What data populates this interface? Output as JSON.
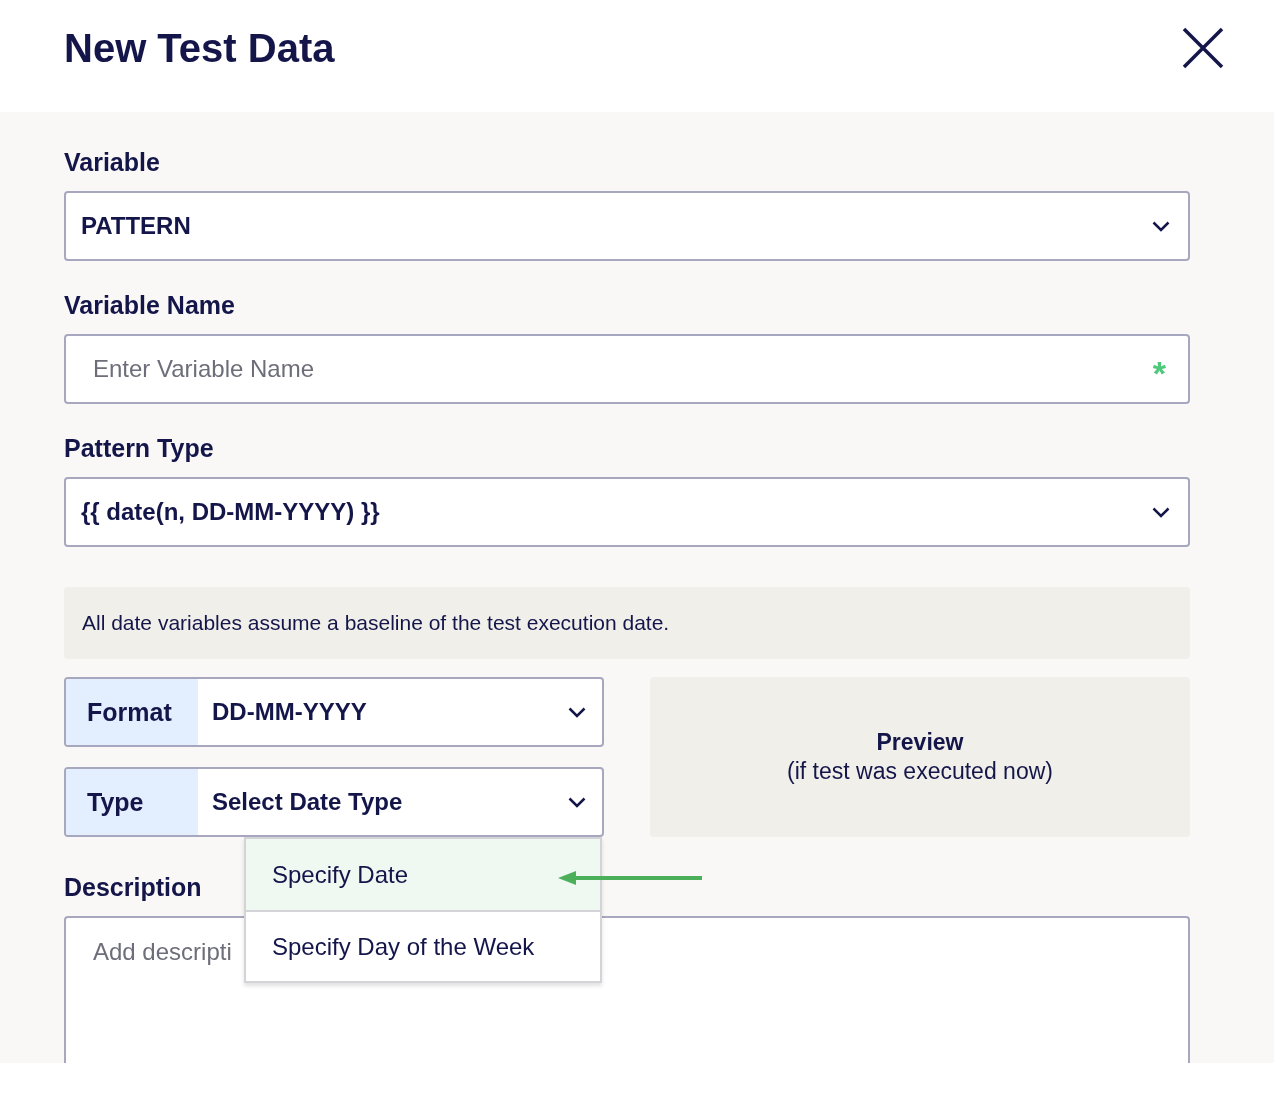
{
  "title": "New Test Data",
  "fields": [
    {
      "kind": "select",
      "label": "Variable",
      "value": "PATTERN"
    },
    {
      "kind": "input",
      "label": "Variable Name",
      "placeholder": "Enter Variable Name",
      "required_mark": "*"
    },
    {
      "kind": "select",
      "label": "Pattern Type",
      "value": "{{ date(n, DD-MM-YYYY) }}"
    }
  ],
  "notice": "All date variables assume a baseline of the test execution date.",
  "date_options": [
    {
      "label": "Format",
      "value": "DD-MM-YYYY",
      "open": false
    },
    {
      "label": "Type",
      "value": "Select Date Type",
      "open": true
    }
  ],
  "type_menu": [
    {
      "label": "Specify Date",
      "highlighted": true
    },
    {
      "label": "Specify Day of the Week",
      "highlighted": false
    }
  ],
  "preview": {
    "title": "Preview",
    "subtitle": "(if test was executed now)"
  },
  "description": {
    "label": "Description",
    "placeholder": "Add descripti"
  }
}
